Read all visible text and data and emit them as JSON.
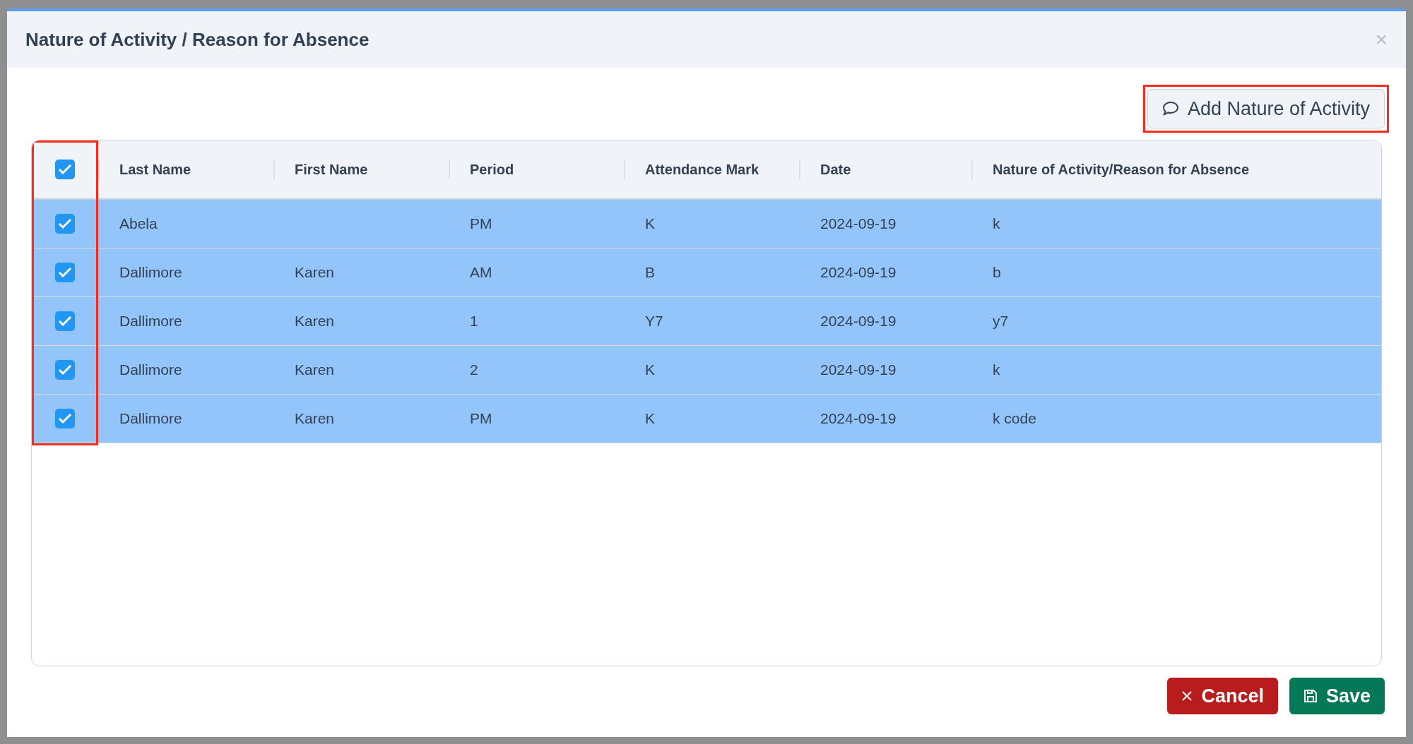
{
  "dialog": {
    "title": "Nature of Activity / Reason for Absence",
    "close": "×"
  },
  "add_button": {
    "label": "Add Nature of Activity"
  },
  "table": {
    "select_all_checked": true,
    "columns": [
      "Last Name",
      "First Name",
      "Period",
      "Attendance Mark",
      "Date",
      "Nature of Activity/Reason for Absence"
    ],
    "rows": [
      {
        "selected": true,
        "checked": true,
        "cells": [
          "Abela",
          "",
          "PM",
          "K",
          "2024-09-19",
          "k"
        ]
      },
      {
        "selected": true,
        "checked": true,
        "cells": [
          "Dallimore",
          "Karen",
          "AM",
          "B",
          "2024-09-19",
          "b"
        ]
      },
      {
        "selected": true,
        "checked": true,
        "cells": [
          "Dallimore",
          "Karen",
          "1",
          "Y7",
          "2024-09-19",
          "y7"
        ]
      },
      {
        "selected": true,
        "checked": true,
        "cells": [
          "Dallimore",
          "Karen",
          "2",
          "K",
          "2024-09-19",
          "k"
        ]
      },
      {
        "selected": true,
        "checked": true,
        "cells": [
          "Dallimore",
          "Karen",
          "PM",
          "K",
          "2024-09-19",
          "k code"
        ]
      }
    ]
  },
  "footer": {
    "cancel": "Cancel",
    "save": "Save"
  }
}
